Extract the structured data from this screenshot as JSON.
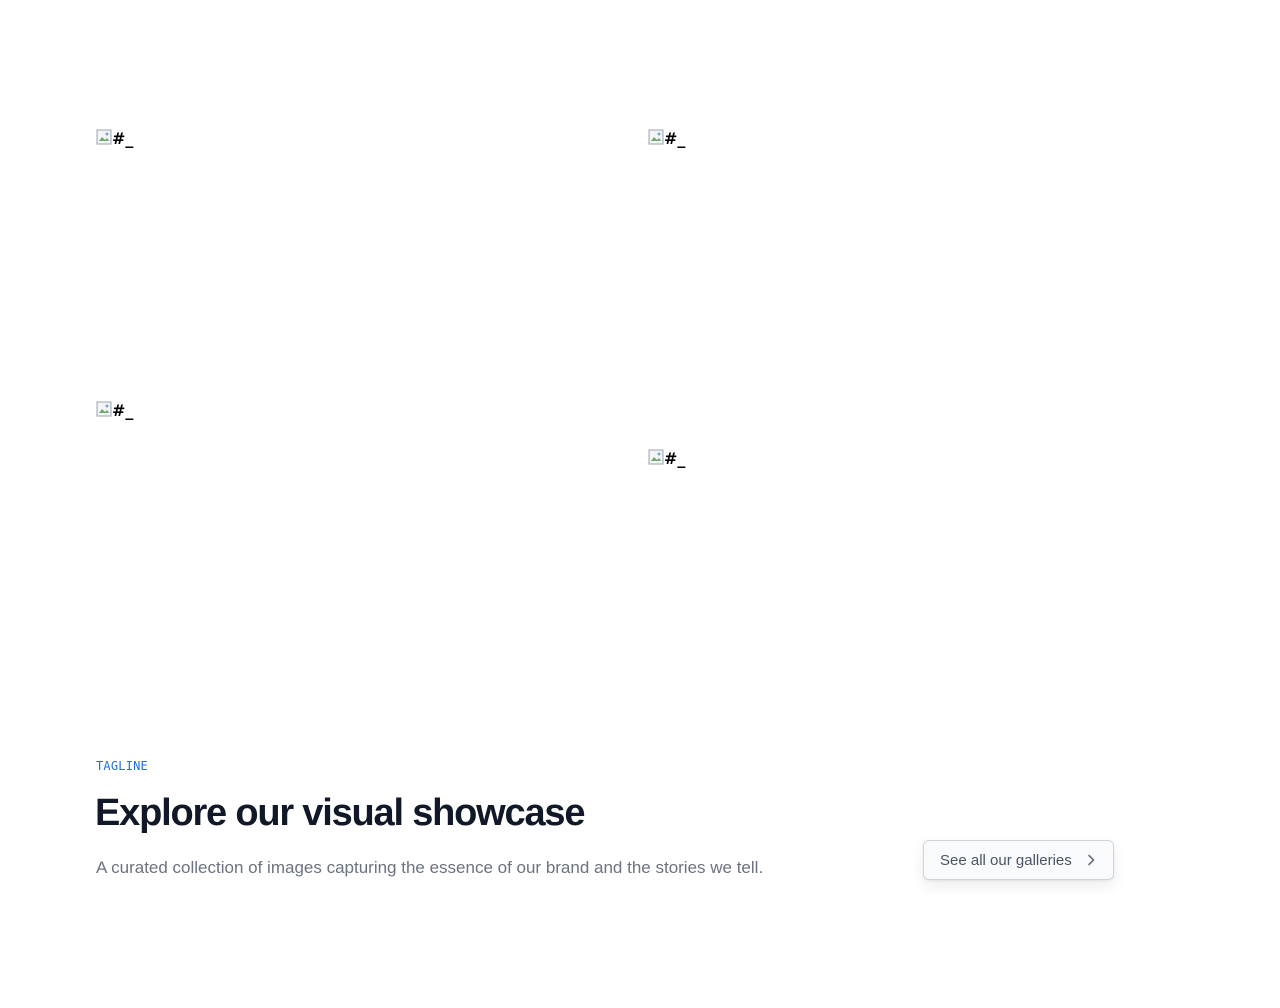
{
  "gallery": {
    "images": [
      {
        "alt": "#_",
        "icon": "broken-image-icon"
      },
      {
        "alt": "#_",
        "icon": "broken-image-icon"
      },
      {
        "alt": "#_",
        "icon": "broken-image-icon"
      },
      {
        "alt": "#_",
        "icon": "broken-image-icon"
      }
    ]
  },
  "hero": {
    "tagline": "TAGLINE",
    "title": "Explore our visual showcase",
    "subtitle": "A curated collection of images capturing the essence of our brand and the stories we tell.",
    "cta_label": "See all our galleries",
    "cta_icon": "chevron-right-icon"
  },
  "colors": {
    "accent": "#1f6fd6",
    "title": "#111827",
    "muted": "#6b7280",
    "button_bg": "#f9fafb",
    "button_border": "#d1d5db"
  }
}
